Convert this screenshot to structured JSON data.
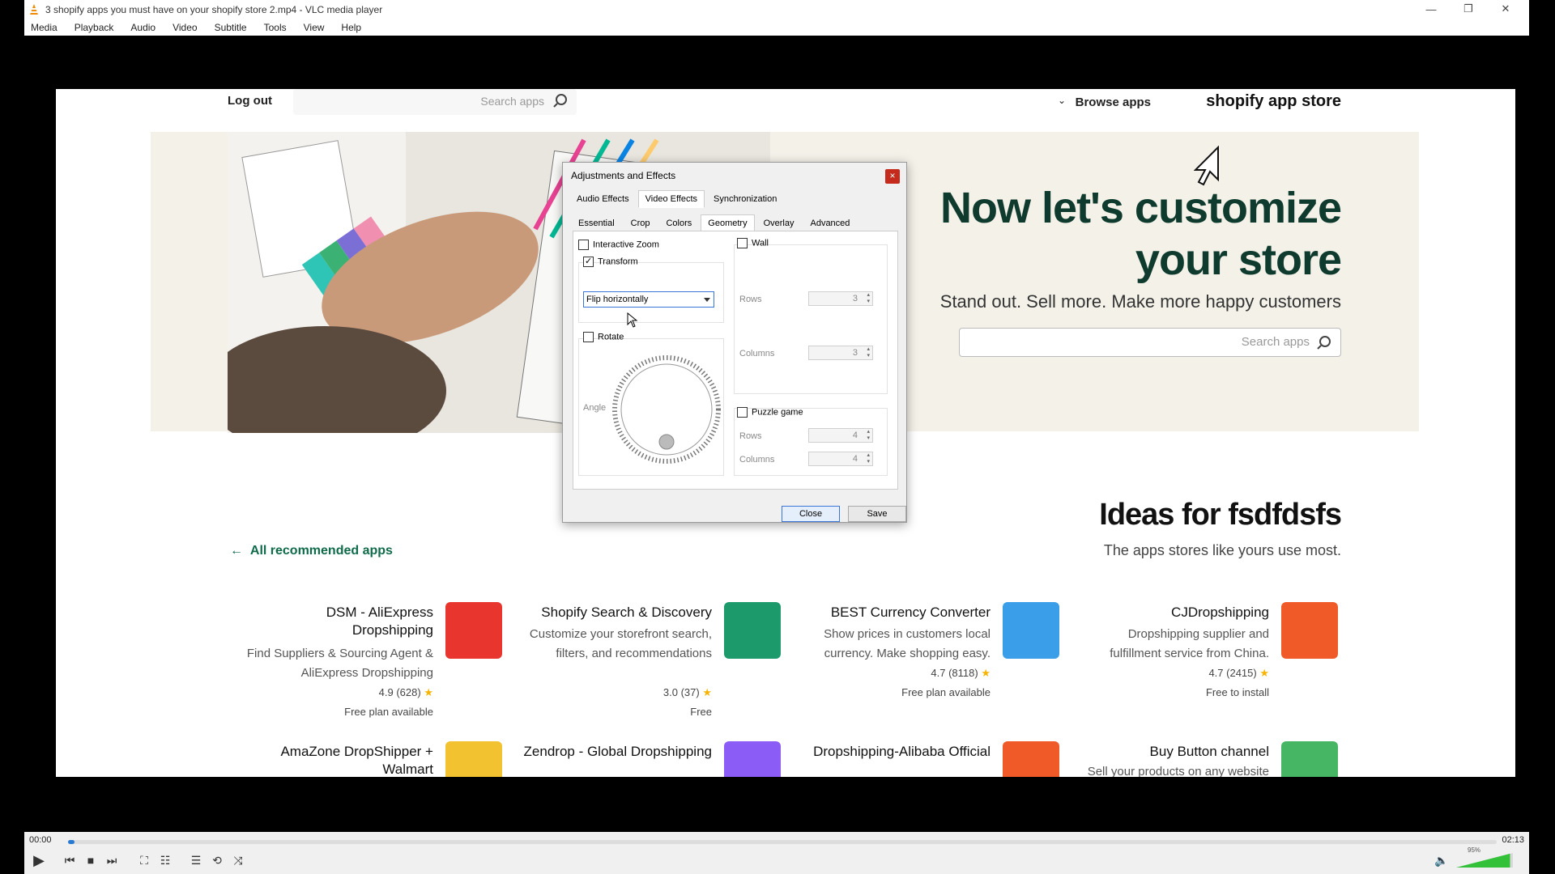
{
  "window": {
    "title": "3 shopify apps you must have on your shopify store 2.mp4 - VLC media player",
    "controls": {
      "minimize": "—",
      "restore": "❐",
      "close": "✕"
    }
  },
  "menubar": [
    "Media",
    "Playback",
    "Audio",
    "Video",
    "Subtitle",
    "Tools",
    "View",
    "Help"
  ],
  "video": {
    "header": {
      "logo": "shopify app store",
      "browse": "Browse apps",
      "search_placeholder": "Search apps",
      "logout": "Log out"
    },
    "hero": {
      "title_line1": "Now let's customize",
      "title_line2": "your store",
      "subtitle": "Stand out. Sell more. Make more happy customers",
      "search_placeholder": "Search apps"
    },
    "section": {
      "title": "Ideas for fsdfdsfs",
      "subtitle": "The apps stores like yours use most.",
      "all_link": "All recommended apps"
    },
    "apps": [
      {
        "name": "CJDropshipping",
        "desc": "Dropshipping supplier and fulfillment service from China.",
        "rating": "4.7 (2415)",
        "price": "Free to install",
        "color": "#f05a28"
      },
      {
        "name": "BEST Currency Converter",
        "desc": "Show prices in customers local currency. Make shopping easy.",
        "rating": "4.7 (8118)",
        "price": "Free plan available",
        "color": "#3a9ee8"
      },
      {
        "name": "Shopify Search & Discovery",
        "desc": "Customize your storefront search, filters, and recommendations",
        "rating": "3.0 (37)",
        "price": "Free",
        "color": "#1c9a6c"
      },
      {
        "name": "DSM - AliExpress Dropshipping",
        "desc": "Find Suppliers & Sourcing Agent & AliExpress Dropshipping",
        "rating": "4.9 (628)",
        "price": "Free plan available",
        "color": "#e8352e"
      },
      {
        "name": "Buy Button channel",
        "desc": "Sell your products on any website",
        "color": "#46b564"
      },
      {
        "name": "Dropshipping-Alibaba Official",
        "desc": "",
        "color": "#f05a28"
      },
      {
        "name": "Zendrop - Global Dropshipping",
        "desc": "",
        "color": "#8b5cf6"
      },
      {
        "name": "AmaZone DropShipper + Walmart",
        "desc": "",
        "color": "#f2c230"
      }
    ]
  },
  "dialog": {
    "title": "Adjustments and Effects",
    "close_x": "×",
    "tabs": [
      "Audio Effects",
      "Video Effects",
      "Synchronization"
    ],
    "active_tab": "Video Effects",
    "subtabs": [
      "Essential",
      "Crop",
      "Colors",
      "Geometry",
      "Overlay",
      "Advanced"
    ],
    "active_subtab": "Geometry",
    "interactive_zoom": "Interactive Zoom",
    "transform": "Transform",
    "transform_value": "Flip horizontally",
    "rotate": "Rotate",
    "angle": "Angle",
    "wall": "Wall",
    "rows": "Rows",
    "columns": "Columns",
    "wall_rows": "3",
    "wall_columns": "3",
    "puzzle": "Puzzle game",
    "puzzle_rows": "4",
    "puzzle_columns": "4",
    "close_btn": "Close",
    "save_btn": "Save"
  },
  "player": {
    "time_current": "00:00",
    "time_total": "02:13",
    "progress": 0.004,
    "volume": "95%",
    "volume_level": 0.95
  }
}
